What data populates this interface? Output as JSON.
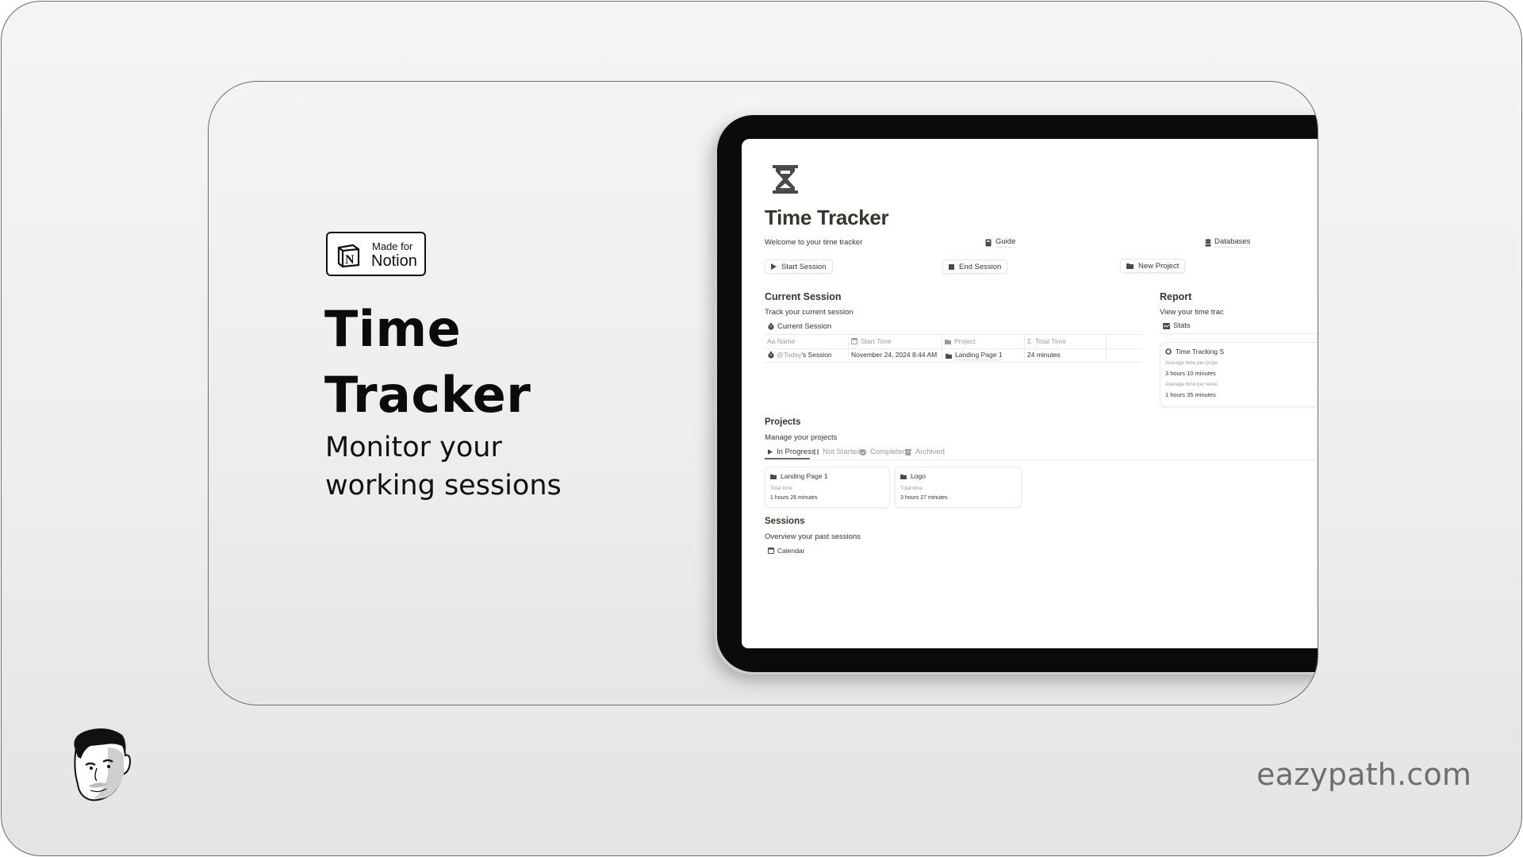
{
  "badge": {
    "line1": "Made for",
    "line2": "Notion",
    "logo_icon": "notion-logo-icon"
  },
  "hero": {
    "title_line1": "Time",
    "title_line2": "Tracker",
    "subtitle_line1": "Monitor your",
    "subtitle_line2": "working sessions"
  },
  "notion_page": {
    "page_icon": "hourglass-icon",
    "title": "Time Tracker",
    "welcome": "Welcome to your time tracker",
    "links": [
      {
        "label": "Guide",
        "icon": "book-icon"
      },
      {
        "label": "Databases",
        "icon": "database-icon"
      }
    ],
    "buttons": [
      {
        "label": "Start Session",
        "icon": "play-icon"
      },
      {
        "label": "End Session",
        "icon": "stop-icon"
      },
      {
        "label": "New Project",
        "icon": "folder-icon"
      }
    ],
    "current_session": {
      "heading": "Current Session",
      "description": "Track your current session",
      "view_label": "Current Session",
      "columns": [
        {
          "label": "Name",
          "icon": "Aa"
        },
        {
          "label": "Start Time",
          "icon": "calendar-icon"
        },
        {
          "label": "Project",
          "icon": "folder-icon"
        },
        {
          "label": "Total Time",
          "icon": "Σ"
        }
      ],
      "rows": [
        {
          "name_mention": "@Today",
          "name_suffix": "'s Session",
          "start_time": "November 24, 2024 8:44 AM",
          "project": "Landing Page 1",
          "total_time": "24 minutes"
        }
      ]
    },
    "report": {
      "heading": "Report",
      "description": "View your time trac",
      "view_label": "Stats",
      "card_title": "Time Tracking S",
      "stats": [
        {
          "label": "Average time per proje",
          "value": "3 hours 10 minutes"
        },
        {
          "label": "Average time per sessi",
          "value": "1 hours 35 minutes"
        }
      ]
    },
    "projects": {
      "heading": "Projects",
      "description": "Manage your projects",
      "tabs": [
        {
          "label": "In Progress",
          "icon": "play-icon",
          "active": true
        },
        {
          "label": "Not Started",
          "icon": "pause-icon",
          "active": false
        },
        {
          "label": "Completed",
          "icon": "check-circle-icon",
          "active": false
        },
        {
          "label": "Archived",
          "icon": "archive-icon",
          "active": false
        }
      ],
      "cards": [
        {
          "title": "Landing Page 1",
          "field_label": "Total time",
          "value": "1 hours 26 minutes"
        },
        {
          "title": "Logo",
          "field_label": "Total time",
          "value": "3 hours 27 minutes"
        }
      ]
    },
    "sessions": {
      "heading": "Sessions",
      "description": "Overview your past sessions",
      "view_label": "Calendar"
    }
  },
  "footer": {
    "website": "eazypath.com",
    "avatar": "author-avatar"
  }
}
